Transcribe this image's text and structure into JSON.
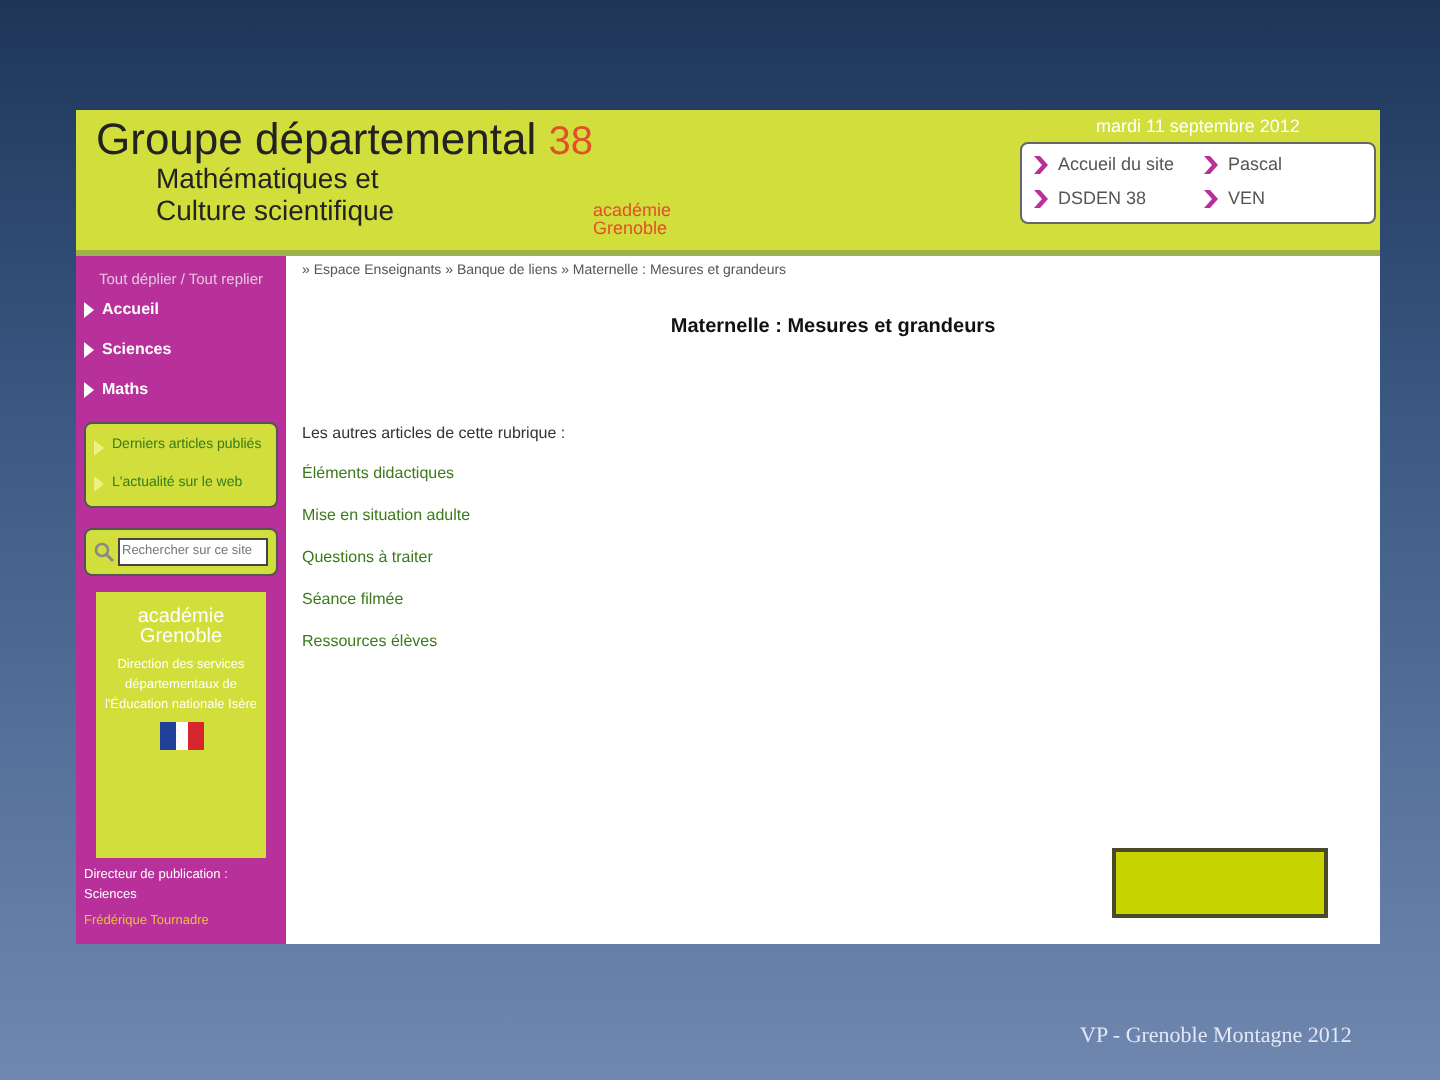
{
  "header": {
    "title": "Groupe départemental",
    "number": "38",
    "subtitle_1": "Mathématiques et",
    "subtitle_2": "Culture scientifique",
    "logo_text_1": "académie",
    "logo_text_2": "Grenoble"
  },
  "date_box": {
    "date": "mardi 11 septembre 2012",
    "links": [
      "Accueil du site",
      "Pascal",
      "DSDEN 38",
      "VEN"
    ]
  },
  "sidebar": {
    "title": "Tout déplier / Tout replier",
    "items": [
      "Accueil",
      "Sciences",
      "Maths"
    ],
    "panel_links": [
      "Derniers articles publiés",
      "L'actualité sur le web"
    ],
    "search": {
      "placeholder": "Rechercher sur ce site"
    },
    "academy": {
      "name_1": "académie",
      "name_2": "Grenoble",
      "text": "Direction des services départementaux de l'Éducation nationale Isère"
    },
    "footer_1": "Directeur de publication : Sciences",
    "footer_2": "Frédérique Tournadre"
  },
  "breadcrumb": "» Espace Enseignants » Banque de liens » Maternelle : Mesures et grandeurs",
  "article": {
    "title": "Maternelle : Mesures et grandeurs",
    "others_label": "Les autres articles de cette rubrique :",
    "links": [
      "Éléments didactiques",
      "Mise en situation adulte",
      "Questions à traiter",
      "Séance filmée",
      "Ressources élèves"
    ]
  },
  "slide_footer": "VP - Grenoble Montagne 2012"
}
